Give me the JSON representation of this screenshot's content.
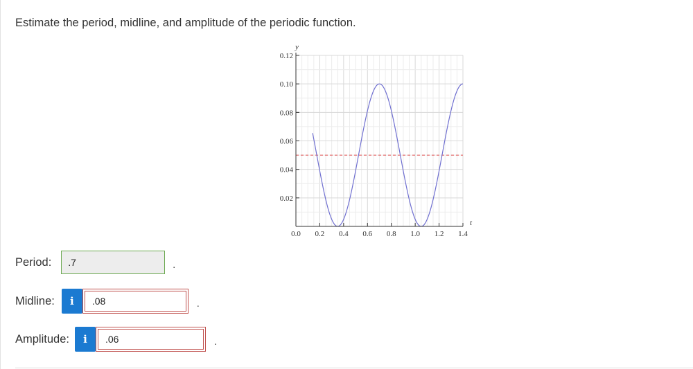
{
  "question": {
    "prompt": "Estimate the period, midline, and amplitude of the periodic function."
  },
  "chart_data": {
    "type": "line",
    "title": "",
    "xlabel": "t",
    "ylabel": "y",
    "xlim": [
      0,
      1.4
    ],
    "ylim": [
      0,
      0.12
    ],
    "x_ticks": [
      "0.0",
      "0.2",
      "0.4",
      "0.6",
      "0.8",
      "1.0",
      "1.2",
      "1.4"
    ],
    "y_ticks": [
      "0.02",
      "0.04",
      "0.06",
      "0.08",
      "0.10",
      "0.12"
    ],
    "grid": true,
    "function": "y = 0.05*cos(2*pi*t/0.7) + 0.05, t in [0.14, 1.4]",
    "series": [
      {
        "color": "#6f6fd0",
        "points": [
          [
            0.14,
            0.0654
          ],
          [
            0.175,
            0.05
          ],
          [
            0.21,
            0.0346
          ],
          [
            0.245,
            0.0206
          ],
          [
            0.28,
            0.0095
          ],
          [
            0.315,
            0.0024
          ],
          [
            0.35,
            0.0
          ],
          [
            0.385,
            0.0024
          ],
          [
            0.42,
            0.0095
          ],
          [
            0.455,
            0.0206
          ],
          [
            0.49,
            0.0346
          ],
          [
            0.525,
            0.05
          ],
          [
            0.56,
            0.0654
          ],
          [
            0.595,
            0.0794
          ],
          [
            0.63,
            0.0905
          ],
          [
            0.665,
            0.0976
          ],
          [
            0.7,
            0.1
          ],
          [
            0.735,
            0.0976
          ],
          [
            0.77,
            0.0905
          ],
          [
            0.805,
            0.0794
          ],
          [
            0.84,
            0.0654
          ],
          [
            0.875,
            0.05
          ],
          [
            0.91,
            0.0346
          ],
          [
            0.945,
            0.0206
          ],
          [
            0.98,
            0.0095
          ],
          [
            1.015,
            0.0024
          ],
          [
            1.05,
            0.0
          ],
          [
            1.085,
            0.0024
          ],
          [
            1.12,
            0.0095
          ],
          [
            1.155,
            0.0206
          ],
          [
            1.19,
            0.0346
          ],
          [
            1.225,
            0.05
          ],
          [
            1.26,
            0.0654
          ],
          [
            1.295,
            0.0794
          ],
          [
            1.33,
            0.0905
          ],
          [
            1.365,
            0.0976
          ],
          [
            1.4,
            0.1
          ]
        ]
      }
    ],
    "reference_line": {
      "y": 0.05,
      "style": "dashed",
      "color": "#e05050"
    }
  },
  "answers": {
    "period": {
      "label": "Period:",
      "value": ".7",
      "status": "correct",
      "status_color": "#6aa84f"
    },
    "midline": {
      "label": "Midline:",
      "value": ".08",
      "status": "incorrect",
      "status_color": "#c0504d",
      "info_glyph": "i"
    },
    "amplitude": {
      "label": "Amplitude:",
      "value": ".06",
      "status": "incorrect",
      "status_color": "#c0504d",
      "info_glyph": "i"
    },
    "trailing_period": "."
  },
  "colors": {
    "info_button": "#1b7ad1",
    "text": "#333333"
  }
}
